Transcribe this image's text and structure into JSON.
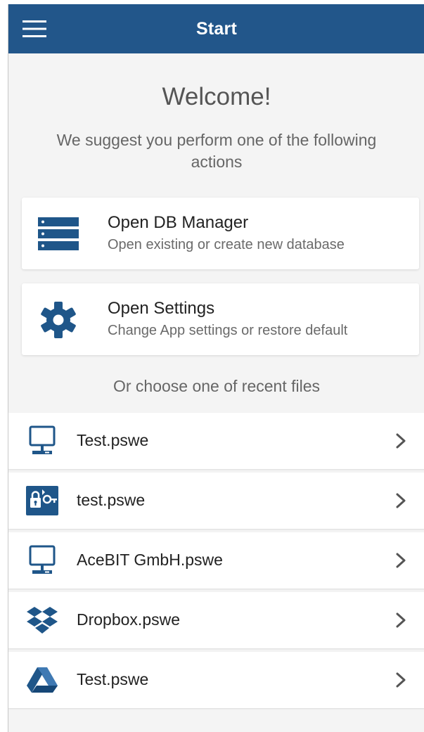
{
  "header": {
    "title": "Start",
    "menu_icon": "hamburger-menu-icon",
    "background": "#22568a"
  },
  "welcome": {
    "title": "Welcome!",
    "subtitle": "We suggest you perform one of the following actions"
  },
  "actions": [
    {
      "title": "Open DB Manager",
      "subtitle": "Open existing or create new database",
      "icon": "database-server-icon"
    },
    {
      "title": "Open Settings",
      "subtitle": "Change App settings or restore default",
      "icon": "gear-icon"
    }
  ],
  "recent": {
    "label": "Or choose one of recent files",
    "files": [
      {
        "name": "Test.pswe",
        "icon": "computer-icon"
      },
      {
        "name": "test.pswe",
        "icon": "password-safe-icon"
      },
      {
        "name": "AceBIT GmbH.pswe",
        "icon": "computer-icon"
      },
      {
        "name": "Dropbox.pswe",
        "icon": "dropbox-icon"
      },
      {
        "name": "Test.pswe",
        "icon": "google-drive-icon"
      }
    ]
  },
  "colors": {
    "accent": "#22568a",
    "icon_blue": "#1f5689",
    "background": "#f4f4f4",
    "card": "#ffffff"
  }
}
